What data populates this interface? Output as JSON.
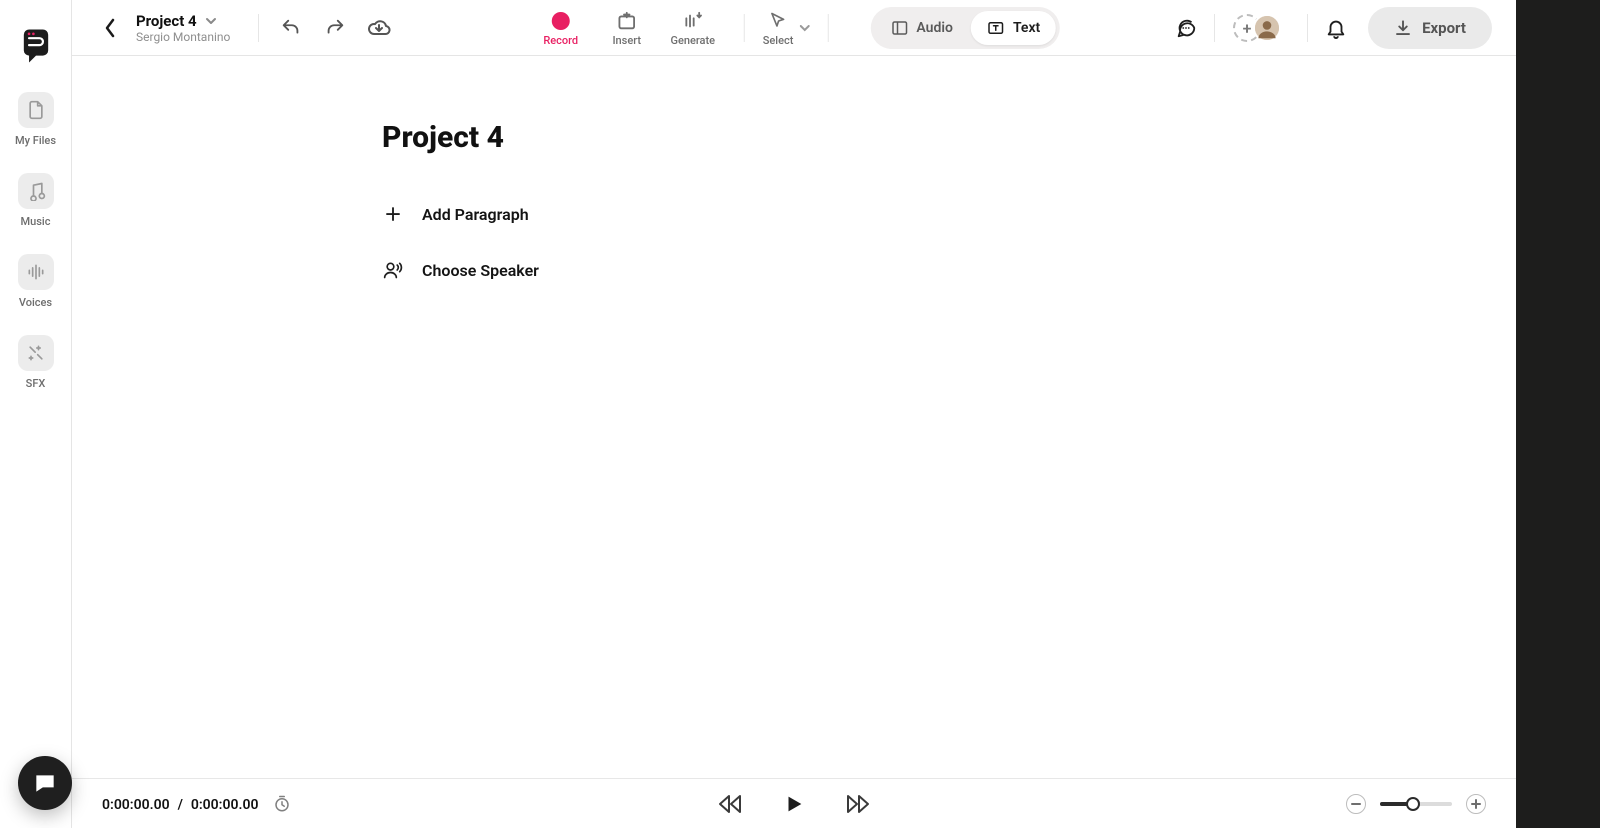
{
  "header": {
    "project_name": "Project 4",
    "author": "Sergio Montanino",
    "export_label": "Export"
  },
  "sidebar": {
    "items": [
      {
        "label": "My Files"
      },
      {
        "label": "Music"
      },
      {
        "label": "Voices"
      },
      {
        "label": "SFX"
      }
    ]
  },
  "center_actions": {
    "record": "Record",
    "insert": "Insert",
    "generate": "Generate",
    "select": "Select"
  },
  "mode_toggle": {
    "audio": "Audio",
    "text": "Text",
    "active": "text"
  },
  "main": {
    "title": "Project 4",
    "add_paragraph": "Add Paragraph",
    "choose_speaker": "Choose Speaker"
  },
  "transport": {
    "current": "0:00:00.00",
    "separator": "/",
    "total": "0:00:00.00"
  },
  "zoom": {
    "value_pct": 46
  }
}
